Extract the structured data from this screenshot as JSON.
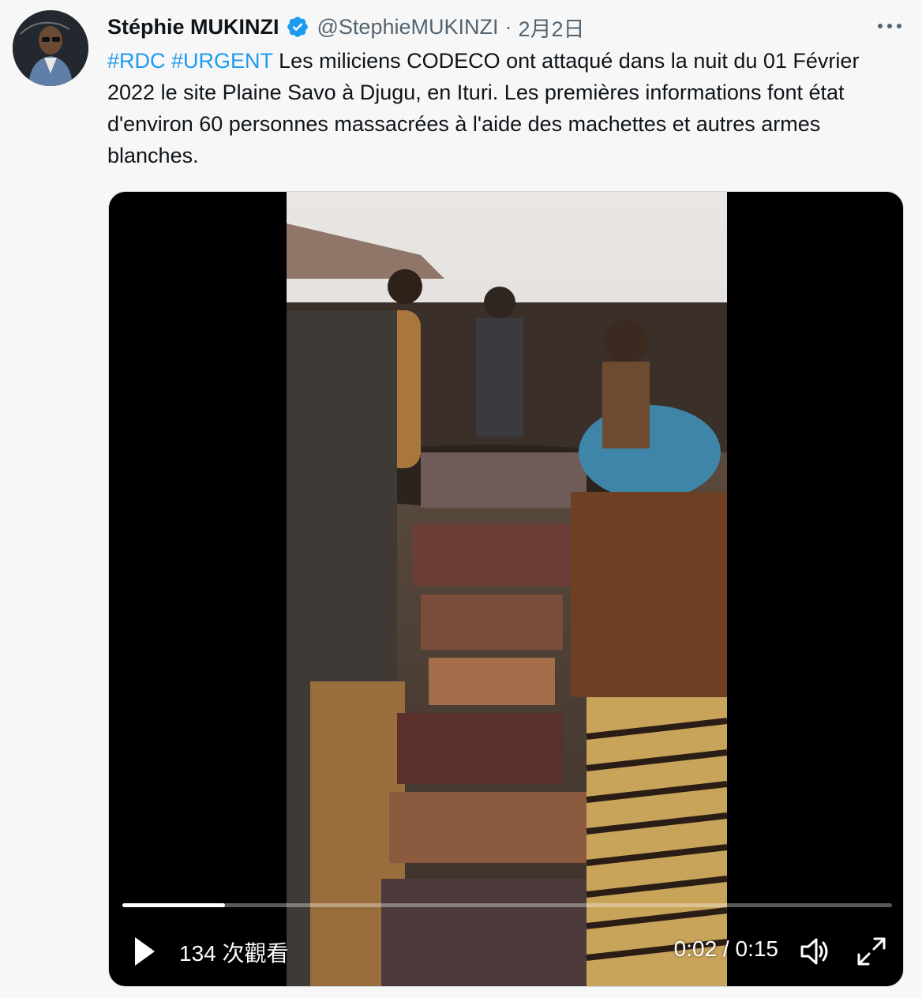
{
  "author": {
    "display_name": "Stéphie MUKINZI",
    "handle": "@StephieMUKINZI",
    "separator": "·",
    "date": "2月2日",
    "verified": true,
    "avatar_icon": "user-photo"
  },
  "tweet": {
    "hashtags": [
      "#RDC",
      "#URGENT"
    ],
    "body": "Les miliciens CODECO ont attaqué dans la nuit du 01 Février 2022 le site Plaine Savo à Djugu, en Ituri. Les premières informations font état d'environ 60 personnes massacrées à l'aide des machettes et autres armes blanches."
  },
  "video": {
    "views_label": "134 次觀看",
    "time_label": "0:02 / 0:15",
    "progress": 0.133,
    "controls": {
      "play_icon": "play-icon",
      "volume_icon": "volume-icon",
      "fullscreen_icon": "fullscreen-icon"
    }
  },
  "menu": {
    "more_icon": "more-horizontal-icon"
  },
  "colors": {
    "link": "#1d9bf0",
    "secondary_text": "#536471",
    "verified": "#1d9bf0",
    "background": "#f7f7f7"
  }
}
